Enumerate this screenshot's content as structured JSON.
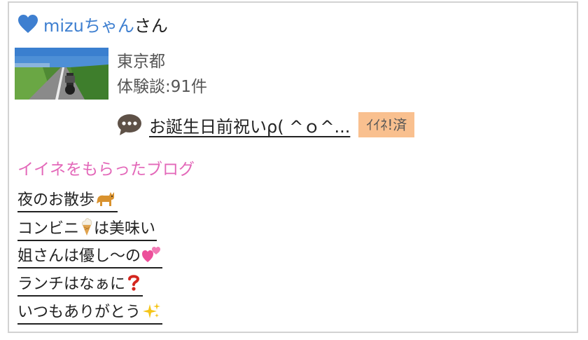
{
  "header": {
    "user_name": "mizuちゃん",
    "suffix": "さん",
    "icon": "heart-icon",
    "name_color": "#3e7fd0"
  },
  "profile": {
    "thumbnail": "road-motorcycle-thumbnail",
    "location": "東京都",
    "stories_count": "体験談:91件"
  },
  "latest_post": {
    "icon": "speech-bubble-icon",
    "title": "お誕生日前祝いρ( ^ｏ^...",
    "badge": "ｲｲﾈ!済",
    "badge_color": "#f9c08f"
  },
  "liked_blogs": {
    "title": "イイネをもらったブログ",
    "title_color": "#e368b9",
    "items": [
      {
        "text": "夜のお散歩",
        "emoji": "cat-emoji"
      },
      {
        "text_before": "コンビニ",
        "emoji": "soft-ice-cream-emoji",
        "text_after": "は美味い"
      },
      {
        "text": "姐さんは優し～の",
        "emoji": "two-hearts-emoji"
      },
      {
        "text": "ランチはなぁに",
        "emoji": "question-mark-emoji"
      },
      {
        "text": "いつもありがとう",
        "emoji": "sparkles-emoji"
      }
    ]
  }
}
